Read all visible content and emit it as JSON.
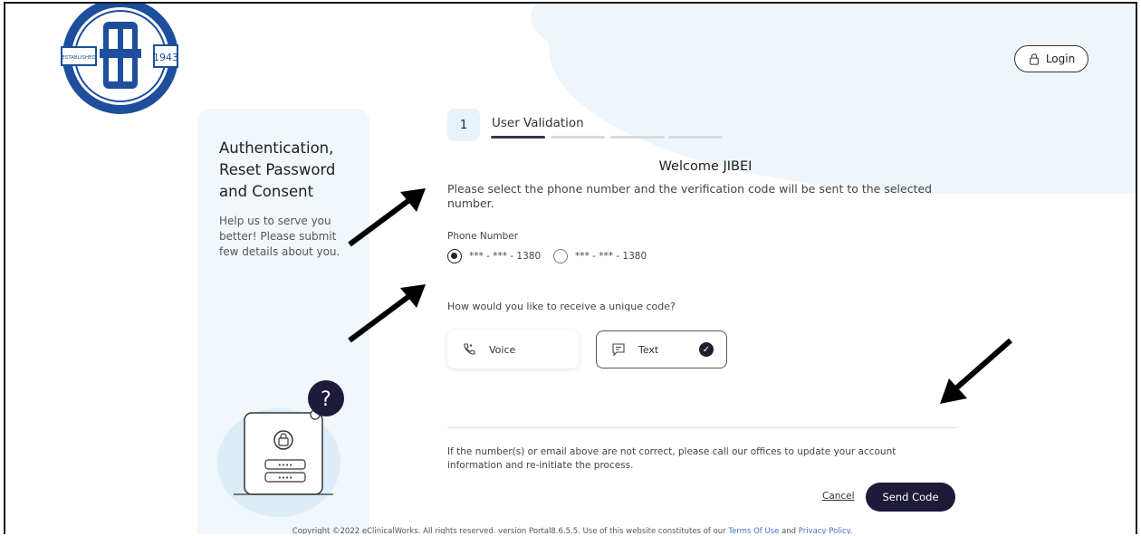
{
  "header": {
    "logo_alt": "Electrical Contractors of New York / Local Union #3, I.B.E.W., AFL-CIO",
    "logo_text_established": "ESTABLISHED",
    "logo_text_year": "1943",
    "login_label": "Login"
  },
  "sidebar": {
    "title": "Authentication, Reset Password and Consent",
    "description": "Help us to serve you better! Please submit few details about you."
  },
  "stepper": {
    "step_number": "1",
    "step_label": "User Validation",
    "total_steps": 4,
    "active_step": 1
  },
  "main": {
    "welcome": "Welcome JIBEI",
    "instruction": "Please select the phone number and the verification code will be sent to the selected number.",
    "phone_label": "Phone Number",
    "phones": [
      {
        "value": "*** - *** - 1380",
        "selected": true
      },
      {
        "value": "*** - *** - 1380",
        "selected": false
      }
    ],
    "code_question": "How would you like to receive a unique code?",
    "methods": [
      {
        "label": "Voice",
        "icon": "phone-icon",
        "selected": false
      },
      {
        "label": "Text",
        "icon": "message-icon",
        "selected": true
      }
    ],
    "notice": "If the number(s) or email above are not correct, please call our offices to update your account information and re-initiate the process.",
    "cancel_label": "Cancel",
    "send_label": "Send Code"
  },
  "footer": {
    "text_prefix": "Copyright ©2022 eClinicalWorks. All rights reserved. version Portal8.6.5.5. Use of this website constitutes of our ",
    "terms_label": "Terms Of Use",
    "and_label": " and ",
    "privacy_label": "Privacy Policy",
    "suffix": "."
  },
  "colors": {
    "primary_button": "#1d1a3a",
    "panel_bg": "#f1f7fb",
    "link": "#4a72c4"
  }
}
